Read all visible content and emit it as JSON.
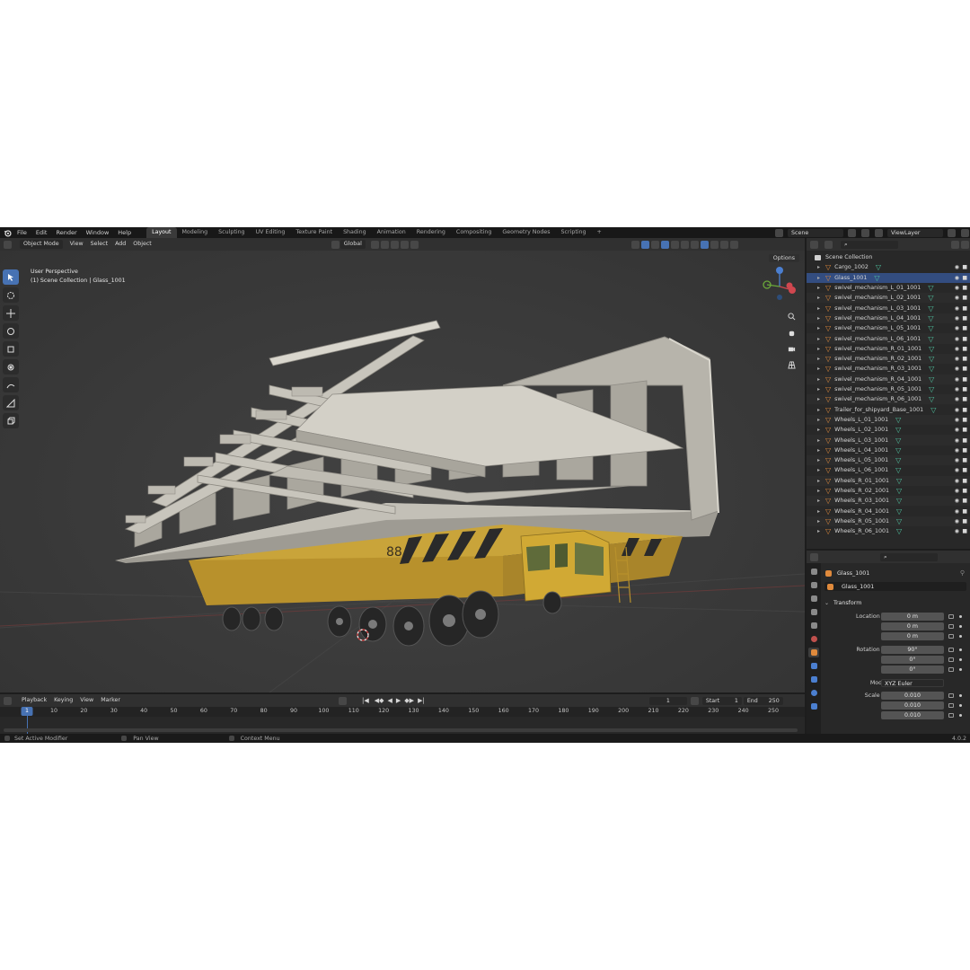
{
  "menu": [
    "File",
    "Edit",
    "Render",
    "Window",
    "Help"
  ],
  "workspaces": [
    "Layout",
    "Modeling",
    "Sculpting",
    "UV Editing",
    "Texture Paint",
    "Shading",
    "Animation",
    "Rendering",
    "Compositing",
    "Geometry Nodes",
    "Scripting"
  ],
  "active_workspace": "Layout",
  "scene_name": "Scene",
  "view_layer": "ViewLayer",
  "viewport_header": {
    "mode": "Object Mode",
    "menus": [
      "View",
      "Select",
      "Add",
      "Object"
    ],
    "orientation": "Global"
  },
  "viewport": {
    "perspective": "User Perspective",
    "collection_info": "(1) Scene Collection | Glass_1001",
    "options": "Options",
    "trailer_number": "88"
  },
  "outliner": {
    "root": "Scene Collection",
    "items": [
      "Cargo_1002",
      "Glass_1001",
      "swivel_mechanism_L_01_1001",
      "swivel_mechanism_L_02_1001",
      "swivel_mechanism_L_03_1001",
      "swivel_mechanism_L_04_1001",
      "swivel_mechanism_L_05_1001",
      "swivel_mechanism_L_06_1001",
      "swivel_mechanism_R_01_1001",
      "swivel_mechanism_R_02_1001",
      "swivel_mechanism_R_03_1001",
      "swivel_mechanism_R_04_1001",
      "swivel_mechanism_R_05_1001",
      "swivel_mechanism_R_06_1001",
      "Trailer_for_shipyard_Base_1001",
      "Wheels_L_01_1001",
      "Wheels_L_02_1001",
      "Wheels_L_03_1001",
      "Wheels_L_04_1001",
      "Wheels_L_05_1001",
      "Wheels_L_06_1001",
      "Wheels_R_01_1001",
      "Wheels_R_02_1001",
      "Wheels_R_03_1001",
      "Wheels_R_04_1001",
      "Wheels_R_05_1001",
      "Wheels_R_06_1001"
    ],
    "selected": "Glass_1001"
  },
  "properties": {
    "object_name": "Glass_1001",
    "data_name": "Glass_1001",
    "panel": "Transform",
    "location": {
      "label": "Location X",
      "x": "0 m",
      "y": "0 m",
      "z": "0 m"
    },
    "rotation": {
      "label": "Rotation X",
      "x": "90°",
      "y": "0°",
      "z": "0°"
    },
    "mode_label": "Mode",
    "mode_value": "XYZ Euler",
    "scale": {
      "label": "Scale X",
      "x": "0.010",
      "y": "0.010",
      "z": "0.010"
    },
    "axis_y": "Y",
    "axis_z": "Z"
  },
  "timeline": {
    "menus": [
      "Playback",
      "Keying",
      "View",
      "Marker"
    ],
    "current_frame": "1",
    "start_label": "Start",
    "start": "1",
    "end_label": "End",
    "end": "250",
    "ticks": [
      "10",
      "20",
      "30",
      "40",
      "50",
      "60",
      "70",
      "80",
      "90",
      "100",
      "110",
      "120",
      "130",
      "140",
      "150",
      "160",
      "170",
      "180",
      "190",
      "200",
      "210",
      "220",
      "230",
      "240",
      "250"
    ],
    "playhead": "1"
  },
  "status": {
    "left": "Set Active Modifier",
    "middle": "Pan View",
    "right": "Context Menu",
    "version": "4.0.2"
  },
  "colors": {
    "accent": "#4772b3",
    "trailer_yellow": "#c9a43a",
    "cargo_grey": "#b9b6ad",
    "object_orange": "#e08a3c",
    "mesh_green": "#4fc3a0"
  }
}
